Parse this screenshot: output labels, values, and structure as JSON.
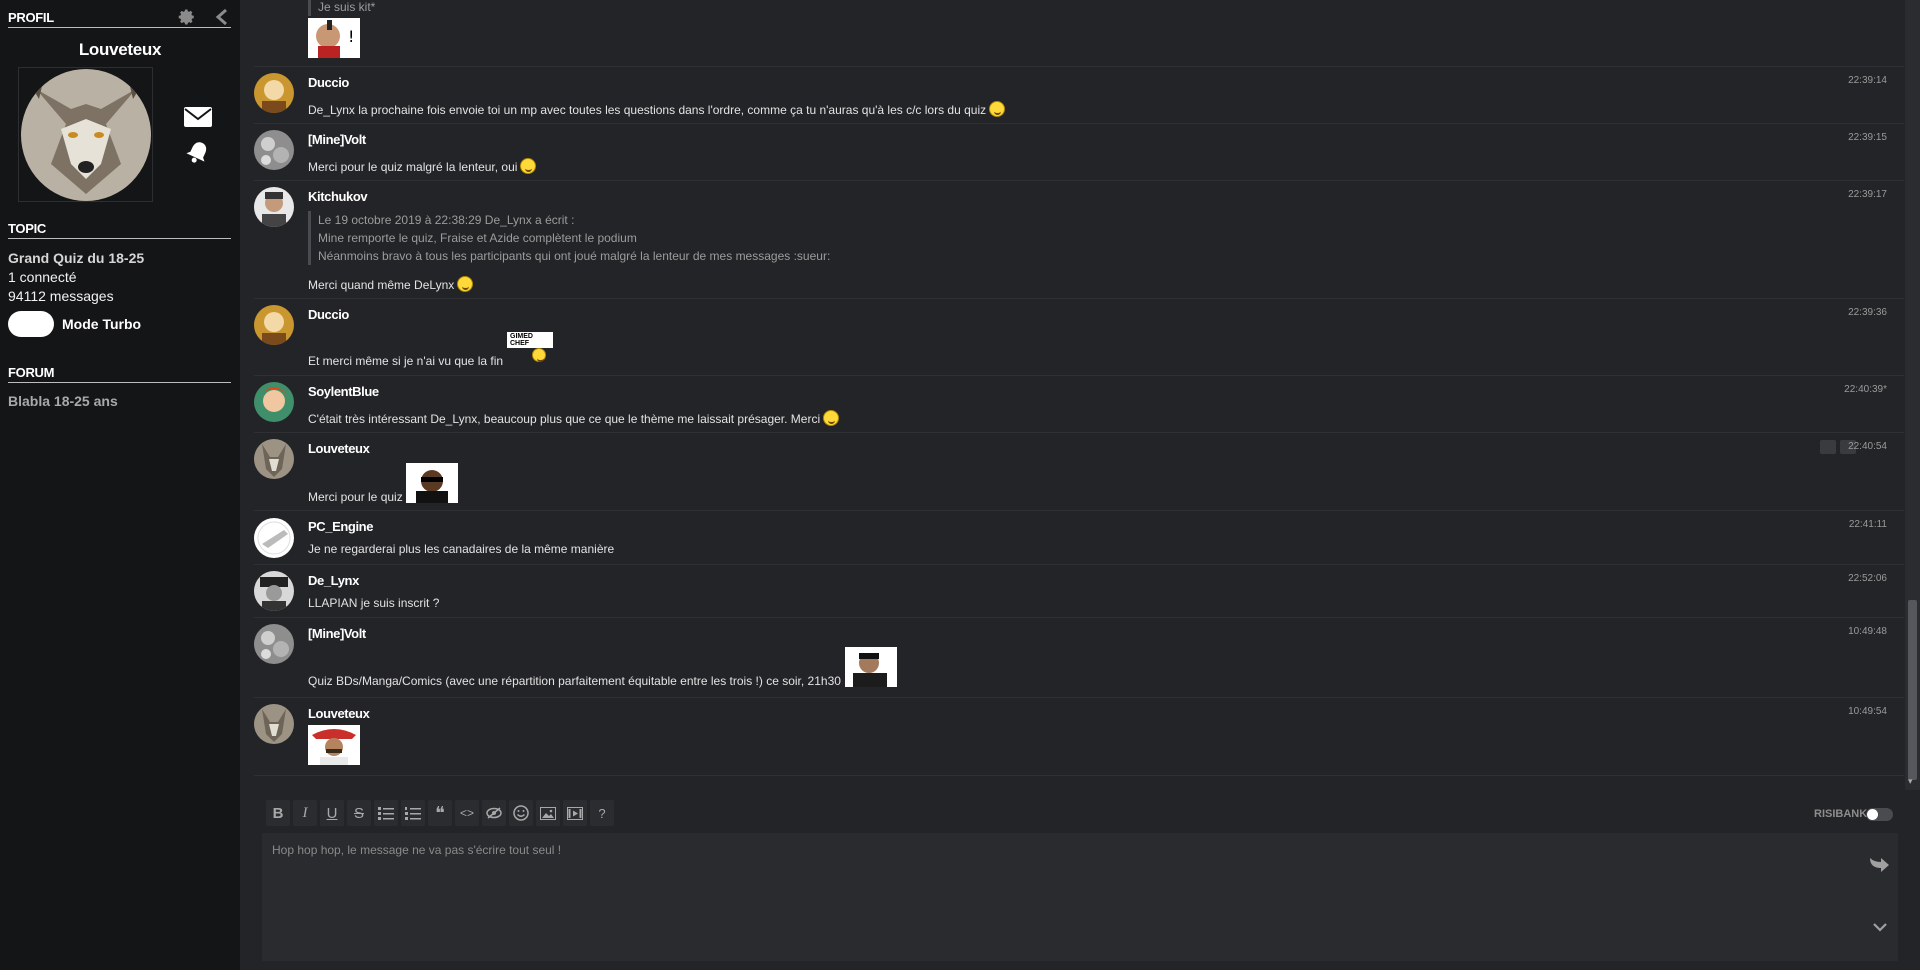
{
  "sidebar": {
    "profile_heading": "PROFIL",
    "username": "Louveteux",
    "topic_heading": "TOPIC",
    "topic_title": "Grand Quiz du 18-25",
    "connected": "1 connecté",
    "messages_count": "94112 messages",
    "turbo_label": "Mode Turbo",
    "forum_heading": "FORUM",
    "forum_name": "Blabla 18-25 ans"
  },
  "messages": [
    {
      "author": "",
      "time": "",
      "text": "Je suis kit*"
    },
    {
      "author": "Duccio",
      "time": "22:39:14",
      "text": "De_Lynx la prochaine fois envoie toi un mp avec toutes les questions dans l'ordre, comme ça tu n'auras qu'à les c/c lors du quiz"
    },
    {
      "author": "[Mine]Volt",
      "time": "22:39:15",
      "text": "Merci pour le quiz malgré la lenteur, oui"
    },
    {
      "author": "Kitchukov",
      "time": "22:39:17",
      "quote": [
        "Le 19 octobre 2019 à 22:38:29 De_Lynx a écrit :",
        "Mine remporte le quiz, Fraise et Azide complètent le podium",
        "Néanmoins bravo à tous les participants qui ont joué malgré la lenteur de mes messages :sueur:"
      ],
      "text": "Merci quand même DeLynx"
    },
    {
      "author": "Duccio",
      "time": "22:39:36",
      "text": "Et merci même si je n'ai vu que la fin",
      "sticker_label": "GIMED CHEF"
    },
    {
      "author": "SoylentBlue",
      "time": "22:40:39*",
      "text": "C'était très intéressant De_Lynx, beaucoup plus que ce que le thème me laissait présager. Merci"
    },
    {
      "author": "Louveteux",
      "time": "22:40:54",
      "text": "Merci pour le quiz"
    },
    {
      "author": "PC_Engine",
      "time": "22:41:11",
      "text": "Je ne regarderai plus les canadaires de la même manière"
    },
    {
      "author": "De_Lynx",
      "time": "22:52:06",
      "text": "LLAPIAN je suis inscrit ?"
    },
    {
      "author": "[Mine]Volt",
      "time": "10:49:48",
      "text": "Quiz BDs/Manga/Comics (avec une répartition parfaitement équitable entre les trois !) ce soir, 21h30"
    },
    {
      "author": "Louveteux",
      "time": "10:49:54",
      "text": ""
    }
  ],
  "composer": {
    "placeholder": "Hop hop hop, le message ne va pas s'écrire tout seul !",
    "risibank_label": "RISIBANK",
    "help_label": "?"
  },
  "colors": {
    "background": "#232427",
    "sidebar": "#141517",
    "smiley": "#ffd83a"
  }
}
